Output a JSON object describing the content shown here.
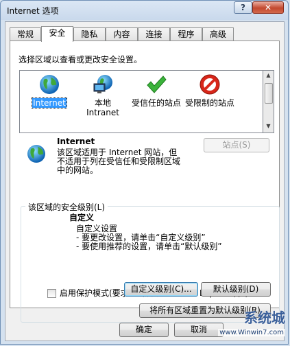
{
  "window": {
    "title": "Internet 选项",
    "help_glyph": "?",
    "close_glyph": "✕"
  },
  "tabs": [
    {
      "label": "常规"
    },
    {
      "label": "安全"
    },
    {
      "label": "隐私"
    },
    {
      "label": "内容"
    },
    {
      "label": "连接"
    },
    {
      "label": "程序"
    },
    {
      "label": "高级"
    }
  ],
  "security": {
    "zone_prompt": "选择区域以查看或更改安全设置。",
    "zones": [
      {
        "label": "Internet",
        "icon": "globe-icon"
      },
      {
        "label": "本地 Intranet",
        "icon": "intranet-icon"
      },
      {
        "label": "受信任的站点",
        "icon": "checkmark-icon"
      },
      {
        "label": "受限制的站点",
        "icon": "no-entry-icon"
      }
    ],
    "selected_zone": {
      "name": "Internet",
      "description": "该区域适用于 Internet 网站，但不适用于列在受信任和受限制区域中的网站。"
    },
    "sites_button": "站点(S)",
    "level_group_title": "该区域的安全级别(L)",
    "custom_title": "自定义",
    "custom_lines": [
      "自定义设置",
      "- 要更改设置，请单击“自定义级别”",
      "- 要使用推荐的设置，请单击“默认级别”"
    ],
    "protected_mode_label": "启用保护模式(要求重新启动 Internet Explorer)(P)",
    "protected_mode_checked": false,
    "custom_level_button": "自定义级别(C)...",
    "default_level_button": "默认级别(D)",
    "reset_all_button": "将所有区域重置为默认级别(R)"
  },
  "footer": {
    "ok": "确定",
    "cancel": "取消"
  },
  "watermark": {
    "brand": "系统城",
    "url": "www.Winwin7.com"
  }
}
